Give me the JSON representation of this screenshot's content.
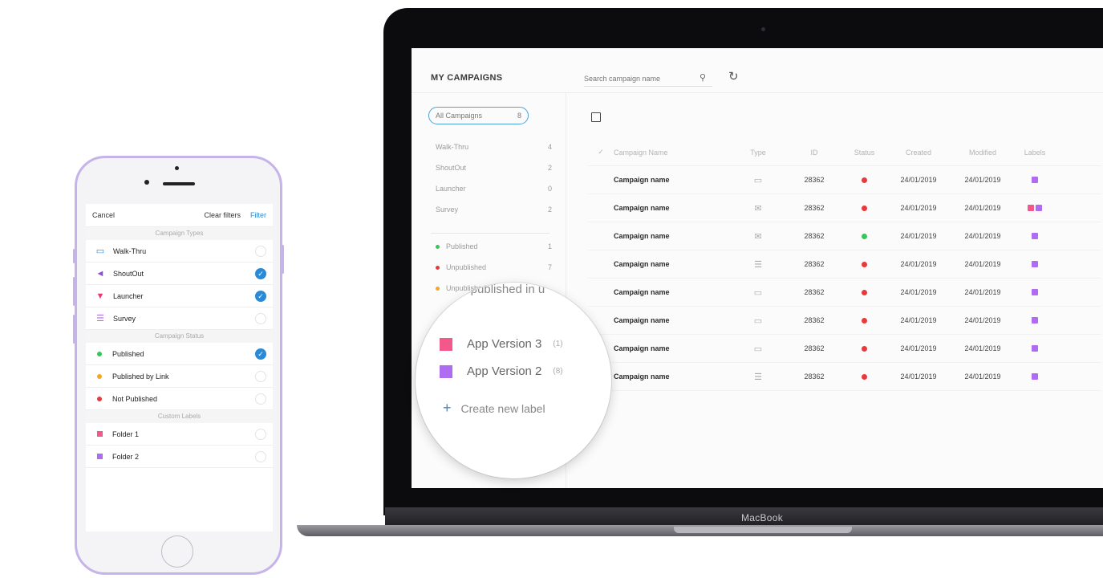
{
  "laptop": {
    "brand_label": "MacBook"
  },
  "app": {
    "title": "MY CAMPAIGNS",
    "search": {
      "placeholder": "Search campaign name"
    },
    "all_campaigns": {
      "label": "All Campaigns",
      "count": "8"
    },
    "campaign_types": [
      {
        "label": "Walk-Thru",
        "count": "4"
      },
      {
        "label": "ShoutOut",
        "count": "2"
      },
      {
        "label": "Launcher",
        "count": "0"
      },
      {
        "label": "Survey",
        "count": "2"
      }
    ],
    "statuses": [
      {
        "label": "Published",
        "count": "1",
        "color": "#34c759"
      },
      {
        "label": "Unpublished",
        "count": "7",
        "color": "#e83a3a"
      },
      {
        "label": "Unpublished in u",
        "count": "",
        "color": "#f5a623"
      }
    ],
    "table": {
      "headers": {
        "check": "✓",
        "name": "Campaign Name",
        "type": "Type",
        "id": "ID",
        "status": "Status",
        "created": "Created",
        "modified": "Modified",
        "labels": "Labels"
      },
      "rows": [
        {
          "name": "Campaign name",
          "type_icon": "walkthru-icon",
          "id": "28362",
          "status_color": "#e83a3a",
          "created": "24/01/2019",
          "modified": "24/01/2019",
          "labels": [
            "#b06cf0"
          ]
        },
        {
          "name": "Campaign name",
          "type_icon": "shoutout-icon",
          "id": "28362",
          "status_color": "#e83a3a",
          "created": "24/01/2019",
          "modified": "24/01/2019",
          "labels": [
            "#f2588a",
            "#b06cf0"
          ]
        },
        {
          "name": "Campaign name",
          "type_icon": "shoutout-icon",
          "id": "28362",
          "status_color": "#34c759",
          "created": "24/01/2019",
          "modified": "24/01/2019",
          "labels": [
            "#b06cf0"
          ]
        },
        {
          "name": "Campaign name",
          "type_icon": "survey-icon",
          "id": "28362",
          "status_color": "#e83a3a",
          "created": "24/01/2019",
          "modified": "24/01/2019",
          "labels": [
            "#b06cf0"
          ]
        },
        {
          "name": "Campaign name",
          "type_icon": "walkthru-icon",
          "id": "28362",
          "status_color": "#e83a3a",
          "created": "24/01/2019",
          "modified": "24/01/2019",
          "labels": [
            "#b06cf0"
          ]
        },
        {
          "name": "Campaign name",
          "type_icon": "walkthru-icon",
          "id": "28362",
          "status_color": "#e83a3a",
          "created": "24/01/2019",
          "modified": "24/01/2019",
          "labels": [
            "#b06cf0"
          ]
        },
        {
          "name": "Campaign name",
          "type_icon": "walkthru-icon",
          "id": "28362",
          "status_color": "#e83a3a",
          "created": "24/01/2019",
          "modified": "24/01/2019",
          "labels": [
            "#b06cf0"
          ]
        },
        {
          "name": "Campaign name",
          "type_icon": "survey-icon",
          "id": "28362",
          "status_color": "#e83a3a",
          "created": "24/01/2019",
          "modified": "24/01/2019",
          "labels": [
            "#b06cf0"
          ]
        }
      ]
    }
  },
  "magnifier": {
    "top_text": "Unpublished in u",
    "top_prefix": "Ur",
    "top_color": "#f5a623",
    "labels": [
      {
        "label": "App Version 3",
        "count": "(1)",
        "color": "#f2588a"
      },
      {
        "label": "App Version 2",
        "count": "(8)",
        "color": "#b06cf0"
      }
    ],
    "create_label": "Create new label"
  },
  "phone": {
    "cancel": "Cancel",
    "clear_filters": "Clear filters",
    "filter": "Filter",
    "sections": {
      "types": "Campaign Types",
      "status": "Campaign Status",
      "labels": "Custom Labels"
    },
    "types": [
      {
        "label": "Walk-Thru",
        "icon": "walkthru-icon",
        "checked": false
      },
      {
        "label": "ShoutOut",
        "icon": "megaphone-icon",
        "checked": true
      },
      {
        "label": "Launcher",
        "icon": "launcher-icon",
        "checked": true
      },
      {
        "label": "Survey",
        "icon": "survey-icon",
        "checked": false
      }
    ],
    "statuses": [
      {
        "label": "Published",
        "color": "#34c759",
        "checked": true
      },
      {
        "label": "Published by Link",
        "color": "#f5a623",
        "checked": false
      },
      {
        "label": "Not Published",
        "color": "#e83a3a",
        "checked": false
      }
    ],
    "labels": [
      {
        "label": "Folder 1",
        "color": "#f2588a",
        "checked": false
      },
      {
        "label": "Folder 2",
        "color": "#b06cf0",
        "checked": false
      }
    ]
  }
}
